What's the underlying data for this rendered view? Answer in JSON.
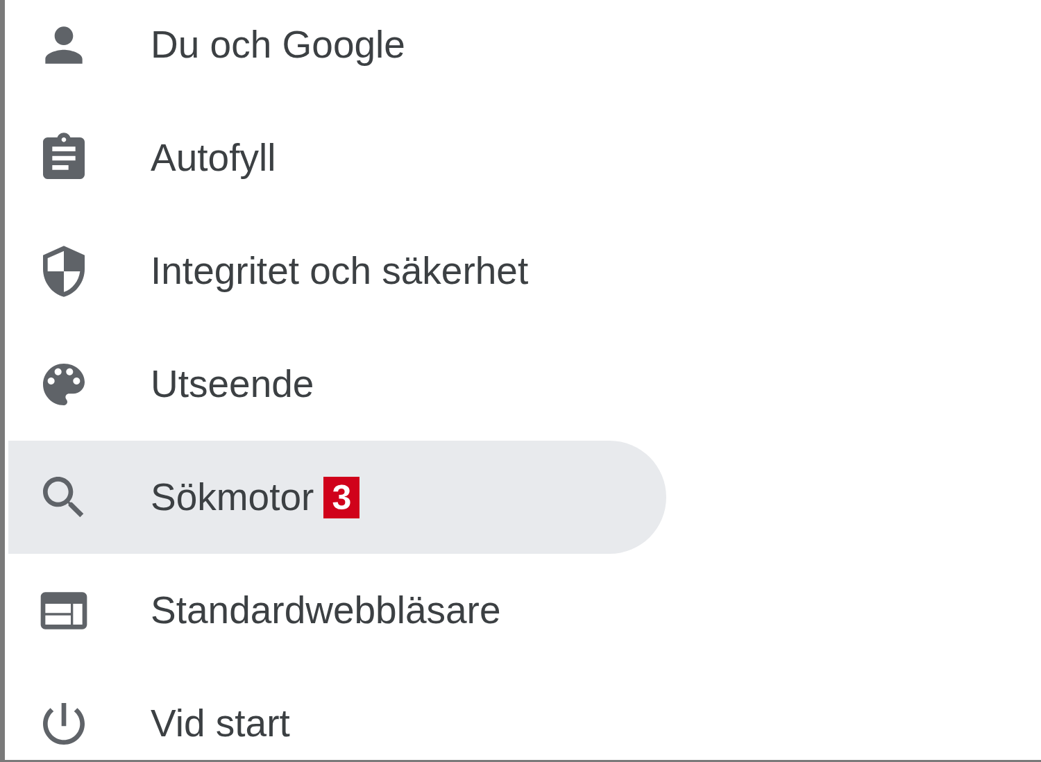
{
  "menu": {
    "items": [
      {
        "label": "Du och Google",
        "selected": false
      },
      {
        "label": "Autofyll",
        "selected": false
      },
      {
        "label": "Integritet och säkerhet",
        "selected": false
      },
      {
        "label": "Utseende",
        "selected": false
      },
      {
        "label": "Sökmotor",
        "selected": true,
        "badge": "3"
      },
      {
        "label": "Standardwebbläsare",
        "selected": false
      },
      {
        "label": "Vid start",
        "selected": false
      }
    ]
  }
}
